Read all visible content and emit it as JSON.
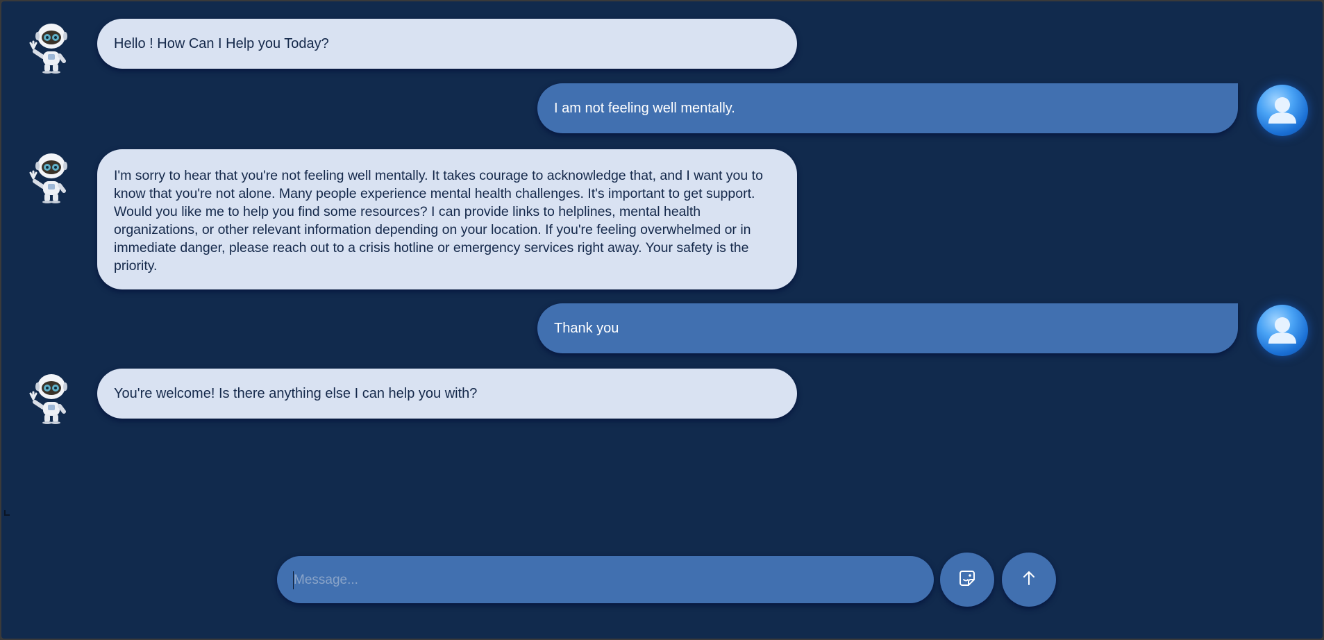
{
  "conversation": {
    "messages": [
      {
        "role": "bot",
        "text": "Hello ! How Can I Help you Today?"
      },
      {
        "role": "user",
        "text": "I am not feeling well mentally."
      },
      {
        "role": "bot",
        "text": "I'm sorry to hear that you're not feeling well mentally. It takes courage to acknowledge that, and I want you to know that you're not alone. Many people experience mental health challenges. It's important to get support. Would you like me to help you find some resources? I can provide links to helplines, mental health organizations, or other relevant information depending on your location. If you're feeling overwhelmed or in immediate danger, please reach out to a crisis hotline or emergency services right away. Your safety is the priority."
      },
      {
        "role": "user",
        "text": "Thank you"
      },
      {
        "role": "bot",
        "text": "You're welcome! Is there anything else I can help you with?"
      }
    ]
  },
  "composer": {
    "placeholder": "Message...",
    "value": ""
  },
  "icons": {
    "bot_avatar": "robot-avatar-icon",
    "user_avatar": "user-avatar-icon",
    "sticker": "sticker-icon",
    "send": "arrow-up-icon"
  },
  "colors": {
    "background": "#112a4d",
    "bot_bubble": "#d9e2f2",
    "user_bubble": "#4170b0",
    "bot_text": "#14284a",
    "user_text": "#ffffff"
  }
}
